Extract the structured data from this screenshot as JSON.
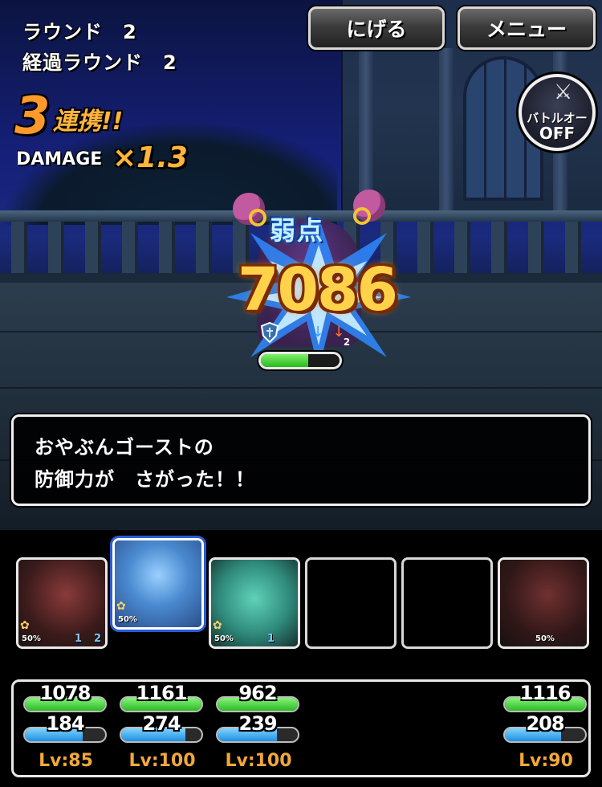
{
  "hud": {
    "round_label": "ラウンド　2",
    "elapsed_label": "経過ラウンド　2",
    "escape_button": "にげる",
    "menu_button": "メニュー",
    "combo_count": "3",
    "combo_label": "連携!!",
    "damage_label": "DAMAGE",
    "damage_multiplier": "×1.3",
    "auto_battle_label": "バトルオート",
    "auto_battle_state": "OFF"
  },
  "enemy": {
    "weakness_label": "弱点",
    "damage_dealt": "7086",
    "hp_fraction": 0.6,
    "status_stack": "2"
  },
  "message": {
    "line1": "おやぶんゴーストの",
    "line2": "防御力が　さがった！！"
  },
  "party": [
    {
      "hp": "1078",
      "mp": "184",
      "level": "Lv:85",
      "hp_fraction": 1.0,
      "mp_fraction": 0.72,
      "tension": "50%",
      "buff1": "1",
      "buff2": "2",
      "accent": "#5a2a2a"
    },
    {
      "hp": "1161",
      "mp": "274",
      "level": "Lv:100",
      "hp_fraction": 1.0,
      "mp_fraction": 0.8,
      "tension": "50%",
      "buff1": "",
      "buff2": "",
      "accent": "#3a7fb0"
    },
    {
      "hp": "962",
      "mp": "239",
      "level": "Lv:100",
      "hp_fraction": 1.0,
      "mp_fraction": 0.74,
      "tension": "50%",
      "buff1": "1",
      "buff2": "",
      "accent": "#2f9a8a"
    },
    {
      "hp": "1116",
      "mp": "208",
      "level": "Lv:90",
      "hp_fraction": 1.0,
      "mp_fraction": 0.7,
      "tension": "50%",
      "buff1": "",
      "buff2": "",
      "accent": "#5a2a2a"
    }
  ],
  "colors": {
    "hp_green": "#2bbb26",
    "mp_blue": "#1e8fe0",
    "level_orange": "#f0a83c",
    "damage_gold": "#ffd24a"
  }
}
